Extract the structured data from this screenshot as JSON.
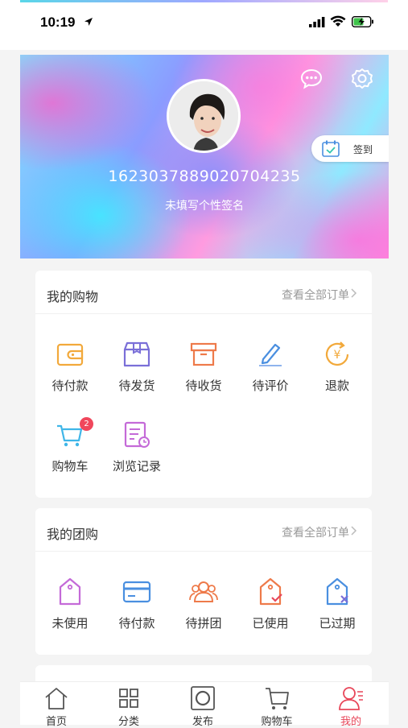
{
  "status": {
    "time": "10:19"
  },
  "profile": {
    "user_id": "1623037889020704235",
    "signature": "未填写个性签名",
    "signin_label": "签到"
  },
  "shopping": {
    "title": "我的购物",
    "more": "查看全部订单",
    "items": [
      {
        "label": "待付款",
        "icon": "wallet-icon"
      },
      {
        "label": "待发货",
        "icon": "package-icon"
      },
      {
        "label": "待收货",
        "icon": "box-icon"
      },
      {
        "label": "待评价",
        "icon": "pen-icon"
      },
      {
        "label": "退款",
        "icon": "refund-icon"
      },
      {
        "label": "购物车",
        "icon": "cart-icon",
        "badge": "2"
      },
      {
        "label": "浏览记录",
        "icon": "history-icon"
      }
    ]
  },
  "group": {
    "title": "我的团购",
    "more": "查看全部订单",
    "items": [
      {
        "label": "未使用",
        "icon": "tag-icon"
      },
      {
        "label": "待付款",
        "icon": "card-icon"
      },
      {
        "label": "待拼团",
        "icon": "group-icon"
      },
      {
        "label": "已使用",
        "icon": "tag-check-icon"
      },
      {
        "label": "已过期",
        "icon": "tag-expired-icon"
      }
    ]
  },
  "tabs": [
    {
      "label": "首页",
      "icon": "home-icon"
    },
    {
      "label": "分类",
      "icon": "grid-icon"
    },
    {
      "label": "发布",
      "icon": "publish-icon"
    },
    {
      "label": "购物车",
      "icon": "cart-icon"
    },
    {
      "label": "我的",
      "icon": "user-icon",
      "active": true
    }
  ],
  "colors": {
    "accent": "#e8475a",
    "badge": "#f0475c"
  }
}
